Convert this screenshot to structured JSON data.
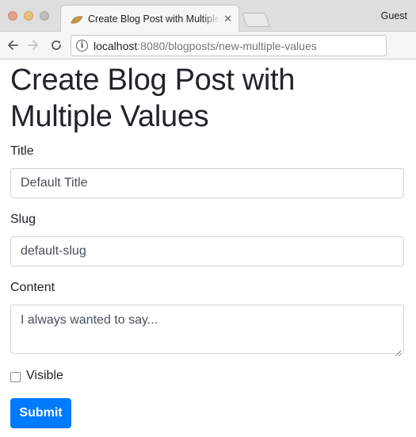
{
  "browser": {
    "tab_title": "Create Blog Post with Multiple Values",
    "profile": "Guest",
    "url_host": "localhost",
    "url_path": ":8080/blogposts/new-multiple-values",
    "icons": {
      "info": "info-icon",
      "back": "back-arrow-icon",
      "forward": "forward-arrow-icon",
      "reload": "reload-icon",
      "close_tab": "close-icon",
      "favicon": "favicon-icon"
    }
  },
  "page": {
    "heading": "Create Blog Post with Multiple Values",
    "title_field": {
      "label": "Title",
      "value": "Default Title"
    },
    "slug_field": {
      "label": "Slug",
      "value": "default-slug"
    },
    "content_field": {
      "label": "Content",
      "value": "I always wanted to say..."
    },
    "visible_checkbox": {
      "label": "Visible",
      "checked": false
    },
    "submit_label": "Submit"
  },
  "colors": {
    "primary": "#007bff",
    "text": "#212529",
    "input_text": "#495057",
    "input_border": "#ced4da"
  }
}
